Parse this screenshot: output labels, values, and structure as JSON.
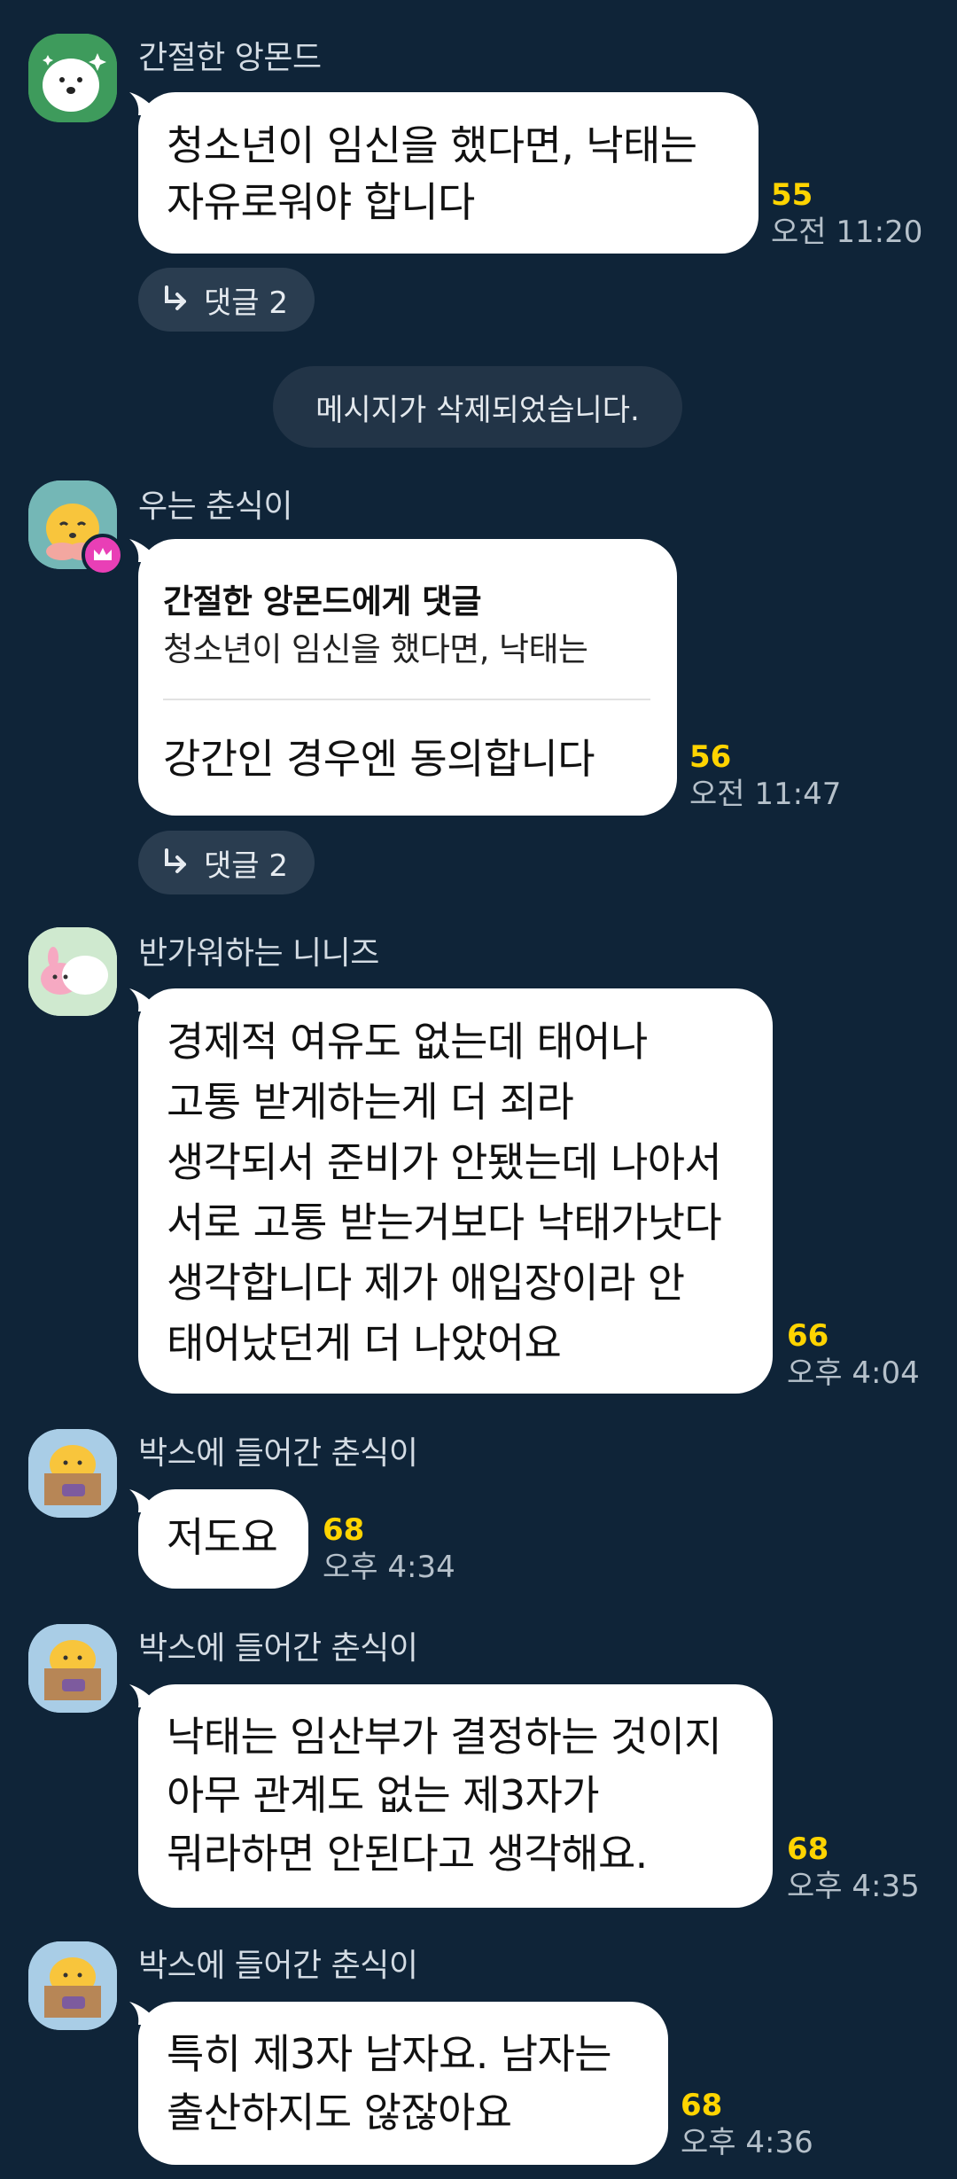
{
  "messages": [
    {
      "sender": "간절한 앙몬드",
      "avatar_icon": "almond-character-icon",
      "lines": [
        "청소년이 임신을 했다면, 낙태는",
        "자유로워야 합니다"
      ],
      "unread_count": "55",
      "time": "오전 11:20",
      "reply_label": "댓글 2"
    },
    {
      "system_text": "메시지가 삭제되었습니다."
    },
    {
      "sender": "우는 춘식이",
      "avatar_icon": "crying-choonsik-icon",
      "has_crown": true,
      "quote_title": "간절한 앙몬드에게 댓글",
      "quote_text": "청소년이 임신을 했다면, 낙태는",
      "lines": [
        "강간인 경우엔 동의합니다"
      ],
      "unread_count": "56",
      "time": "오전 11:47",
      "reply_label": "댓글 2"
    },
    {
      "sender": "반가워하는 니니즈",
      "avatar_icon": "niniz-characters-icon",
      "lines": [
        "경제적 여유도 없는데 태어나",
        "고통 받게하는게 더 죄라",
        "생각되서 준비가 안됐는데 나아서",
        "서로 고통 받는거보다 낙태가낫다",
        "생각합니다 제가 애입장이라 안",
        "태어났던게 더 나았어요"
      ],
      "unread_count": "66",
      "time": "오후 4:04"
    },
    {
      "sender": "박스에 들어간 춘식이",
      "avatar_icon": "choonsik-in-box-icon",
      "lines": [
        "저도요"
      ],
      "unread_count": "68",
      "time": "오후 4:34"
    },
    {
      "sender": "박스에 들어간 춘식이",
      "avatar_icon": "choonsik-in-box-icon",
      "lines": [
        "낙태는 임산부가 결정하는 것이지",
        "아무 관계도 없는 제3자가",
        "뭐라하면 안된다고 생각해요."
      ],
      "unread_count": "68",
      "time": "오후 4:35"
    },
    {
      "sender": "박스에 들어간 춘식이",
      "avatar_icon": "choonsik-in-box-icon",
      "lines": [
        "특히 제3자 남자요. 남자는",
        "출산하지도 않잖아요"
      ],
      "unread_count": "68",
      "time": "오후 4:36"
    }
  ],
  "colors": {
    "background": "#0f2438",
    "bubble": "#ffffff",
    "unread": "#ffd400",
    "chip": "#2a3d50",
    "crown_badge": "#e93fb6"
  }
}
